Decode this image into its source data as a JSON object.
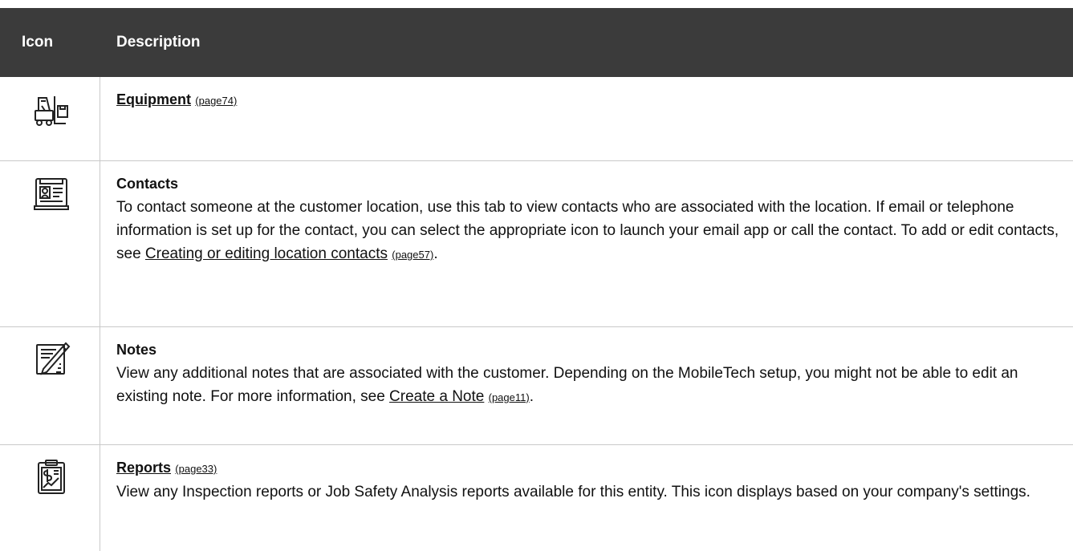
{
  "header": {
    "col_icon": "Icon",
    "col_description": "Description"
  },
  "rows": [
    {
      "icon": "forklift-icon",
      "title": "Equipment",
      "title_ref": "(page74)"
    },
    {
      "icon": "contacts-card-icon",
      "title": "Contacts",
      "text_before": "To contact someone at the customer location, use this tab to view contacts who are associated with the location. If email or telephone information is set up for the contact, you can select the appropriate icon to launch your email app or call the contact. To add or edit contacts, see ",
      "link": "Creating or editing location contacts",
      "link_ref": "(page57)",
      "text_after": "."
    },
    {
      "icon": "notes-pencil-icon",
      "title": "Notes",
      "text_before": "View any additional notes that are associated with the customer. Depending on the MobileTech setup, you might not be able to edit an existing note. For more information, see ",
      "link": "Create a Note",
      "link_ref": "(page11)",
      "text_after": "."
    },
    {
      "icon": "report-clipboard-icon",
      "title": "Reports",
      "title_ref": "(page33)",
      "text": "View any Inspection reports or Job Safety Analysis reports available for this entity. This icon displays based on your company's settings."
    }
  ]
}
